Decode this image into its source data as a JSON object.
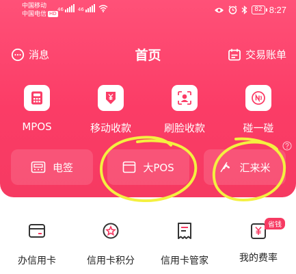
{
  "status_bar": {
    "carrier_1": "中国移动",
    "carrier_2": "中国电信",
    "hd_badge": "HD",
    "signal_label_1": "46",
    "signal_label_2": "46",
    "battery": "82",
    "time": "8:27",
    "icons": [
      "eye-icon",
      "alarm-icon",
      "bluetooth-icon",
      "wifi-icon"
    ]
  },
  "header": {
    "title": "首页",
    "messages_label": "消息",
    "ledger_label": "交易账单"
  },
  "quick_actions": [
    {
      "label": "MPOS",
      "icon": "calculator-icon"
    },
    {
      "label": "移动收款",
      "icon": "yen-download-icon"
    },
    {
      "label": "刷脸收款",
      "icon": "face-scan-icon"
    },
    {
      "label": "碰一碰",
      "icon": "nfc-icon"
    }
  ],
  "settlement": [
    {
      "label": "电签",
      "icon": "pos-terminal-icon"
    },
    {
      "label": "大POS",
      "icon": "window-icon"
    },
    {
      "label": "汇来米",
      "icon": "rice-icon"
    }
  ],
  "services": [
    {
      "label": "办信用卡",
      "icon": "credit-card-icon"
    },
    {
      "label": "信用卡积分",
      "icon": "star-badge-icon"
    },
    {
      "label": "信用卡管家",
      "icon": "receipt-icon"
    },
    {
      "label": "我的费率",
      "icon": "yen-rate-icon",
      "badge": "省钱"
    }
  ],
  "colors": {
    "brand": "#fb3c66",
    "annotation": "#f4f040"
  }
}
